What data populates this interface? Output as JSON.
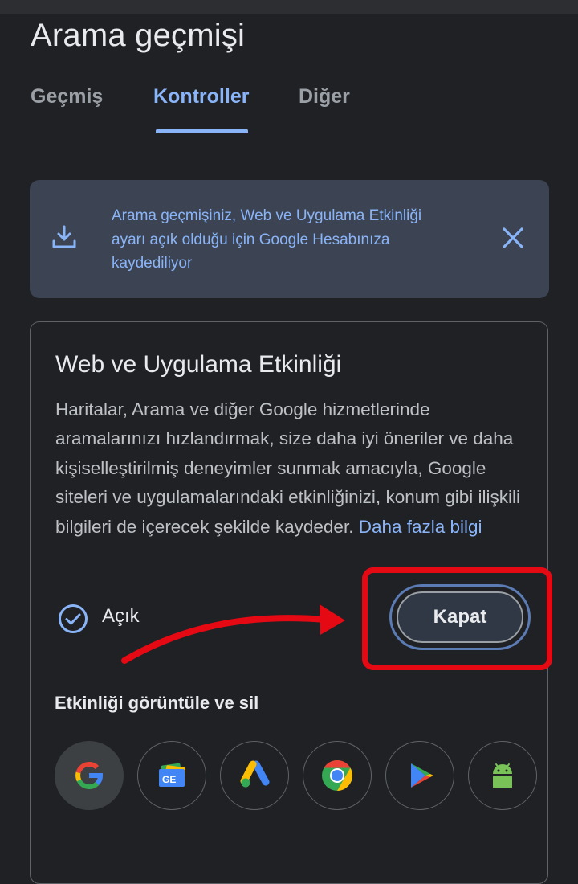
{
  "page": {
    "title": "Arama geçmişi"
  },
  "tabs": [
    {
      "label": "Geçmiş",
      "active": false
    },
    {
      "label": "Kontroller",
      "active": true
    },
    {
      "label": "Diğer",
      "active": false
    }
  ],
  "banner": {
    "icon": "download-icon",
    "text": "Arama geçmişiniz, Web ve Uygulama Etkinliği ayarı açık olduğu için Google Hesabınıza kaydediliyor",
    "close_icon": "close-icon"
  },
  "card": {
    "title": "Web ve Uygulama Etkinliği",
    "description": "Haritalar, Arama ve diğer Google hizmetlerinde aramalarınızı hızlandırmak, size daha iyi öneriler ve daha kişiselleştirilmiş deneyimler sunmak amacıyla, Google siteleri ve uygulamalarındaki etkinliğinizi, konum gibi ilişkili bilgileri de içerecek şekilde kaydeder.",
    "link": "Daha fazla bilgi",
    "status_icon": "check-circle-icon",
    "status": "Açık",
    "button": "Kapat"
  },
  "activity": {
    "title": "Etkinliği görüntüle ve sil",
    "apps": [
      "google-icon",
      "google-news-icon",
      "google-ads-icon",
      "chrome-icon",
      "google-play-icon",
      "android-icon"
    ]
  },
  "colors": {
    "accent": "#8ab4f8",
    "annotation": "#e50914",
    "background": "#202124"
  }
}
